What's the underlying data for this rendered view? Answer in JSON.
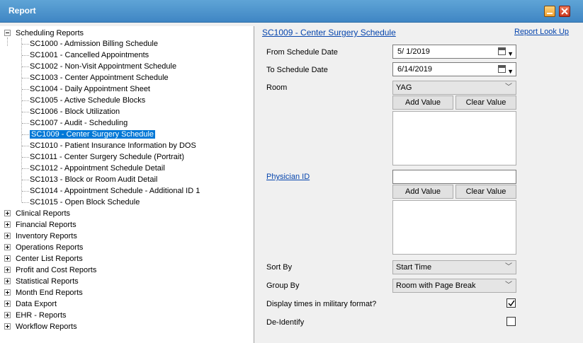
{
  "window": {
    "title": "Report"
  },
  "tree": {
    "root": "Scheduling Reports",
    "children": [
      "SC1000 - Admission Billing Schedule",
      "SC1001 - Cancelled Appointments",
      "SC1002 - Non-Visit Appointment Schedule",
      "SC1003 - Center Appointment Schedule",
      "SC1004 - Daily Appointment Sheet",
      "SC1005 - Active Schedule Blocks",
      "SC1006 - Block Utilization",
      "SC1007 - Audit - Scheduling",
      "SC1009 - Center Surgery Schedule",
      "SC1010 - Patient Insurance Information by DOS",
      "SC1011 - Center Surgery Schedule (Portrait)",
      "SC1012 - Appointment Schedule Detail",
      "SC1013 - Block or Room Audit Detail",
      "SC1014 - Appointment Schedule - Additional ID 1",
      "SC1015 - Open Block Schedule"
    ],
    "selected_index": 8,
    "groups": [
      "Clinical Reports",
      "Financial Reports",
      "Inventory Reports",
      "Operations Reports",
      "Center List Reports",
      "Profit and Cost Reports",
      "Statistical Reports",
      "Month End Reports",
      "Data Export",
      "EHR - Reports",
      "Workflow Reports"
    ]
  },
  "form": {
    "report_title": "SC1009 - Center Surgery Schedule",
    "lookup_link": "Report Look Up",
    "from_date_label": "From Schedule Date",
    "from_date_value": "5/  1/2019",
    "to_date_label": "To Schedule Date",
    "to_date_value": "6/14/2019",
    "room_label": "Room",
    "room_value": "YAG",
    "add_value": "Add Value",
    "clear_value": "Clear Value",
    "physician_label": "Physician ID",
    "physician_value": "",
    "sort_label": "Sort By",
    "sort_value": "Start Time",
    "group_label": "Group By",
    "group_value": "Room with Page Break",
    "military_label": "Display times in military format?",
    "military_checked": true,
    "deidentify_label": "De-Identify",
    "deidentify_checked": false
  }
}
